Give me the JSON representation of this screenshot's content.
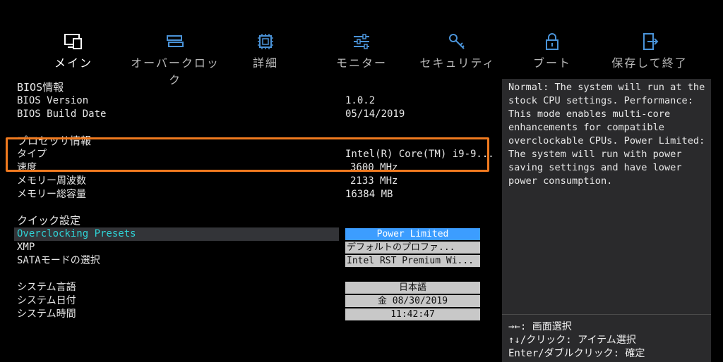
{
  "tabs": [
    {
      "label": "メイン",
      "icon": "computer-icon"
    },
    {
      "label": "オーバークロック",
      "icon": "overclock-icon"
    },
    {
      "label": "詳細",
      "icon": "cpu-chip-icon"
    },
    {
      "label": "モニター",
      "icon": "sliders-icon"
    },
    {
      "label": "セキュリティ",
      "icon": "key-icon"
    },
    {
      "label": "ブート",
      "icon": "lock-icon"
    },
    {
      "label": "保存して終了",
      "icon": "exit-door-icon"
    }
  ],
  "bios": {
    "title": "BIOS情報",
    "version_label": "BIOS Version",
    "version_value": "1.0.2",
    "build_label": "BIOS Build Date",
    "build_value": "05/14/2019"
  },
  "processor": {
    "title": "プロセッサ情報",
    "type_label": "タイプ",
    "type_value": "Intel(R) Core(TM) i9-9...",
    "speed_label": "速度",
    "speed_value": "3600 MHz",
    "memfreq_label": "メモリー周波数",
    "memfreq_value": "2133 MHz",
    "memtotal_label": "メモリー総容量",
    "memtotal_value": "16384 MB"
  },
  "quick": {
    "title": "クイック設定",
    "oc_label": "Overclocking Presets",
    "oc_value": "Power Limited",
    "xmp_label": "XMP",
    "xmp_value": "デフォルトのプロファ...",
    "sata_label": "SATAモードの選択",
    "sata_value": "Intel RST Premium Wi..."
  },
  "system": {
    "lang_label": "システム言語",
    "lang_value": "日本語",
    "date_label": "システム日付",
    "date_value": "金 08/30/2019",
    "time_label": "システム時間",
    "time_value": "11:42:47"
  },
  "help": {
    "text": "Normal: The system will run at the stock CPU settings. Performance: This mode enables multi-core enhancements for compatible overclockable CPUs. Power Limited: The system will run with power saving settings and have lower power consumption.",
    "key1": "→←: 画面選択",
    "key2": "↑↓/クリック: アイテム選択",
    "key3": "Enter/ダブルクリック: 確定"
  },
  "colors": {
    "selected_box": "#3c9dff",
    "selected_text": "#2fd3d6",
    "highlight": "#f07a1f",
    "icon": "#4a93d8"
  }
}
